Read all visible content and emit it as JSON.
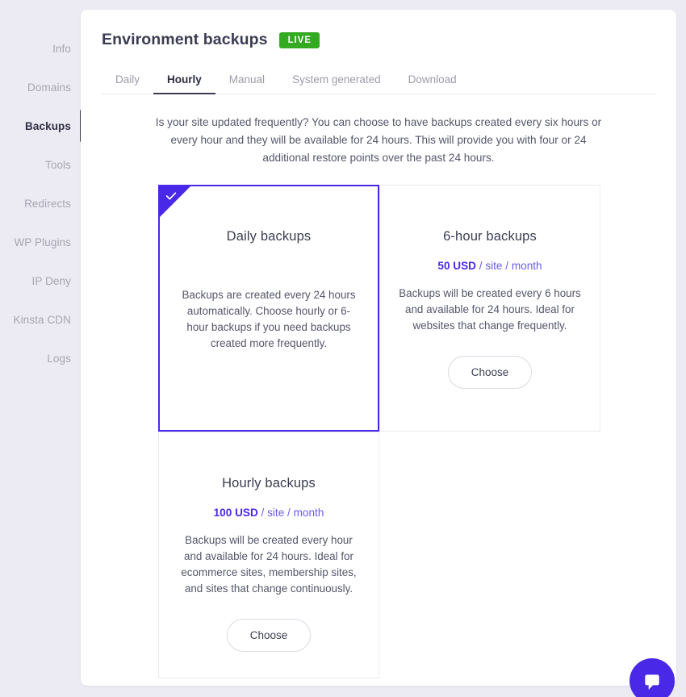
{
  "sidebar": {
    "items": [
      {
        "label": "Info",
        "active": false
      },
      {
        "label": "Domains",
        "active": false
      },
      {
        "label": "Backups",
        "active": true
      },
      {
        "label": "Tools",
        "active": false
      },
      {
        "label": "Redirects",
        "active": false
      },
      {
        "label": "WP Plugins",
        "active": false
      },
      {
        "label": "IP Deny",
        "active": false
      },
      {
        "label": "Kinsta CDN",
        "active": false
      },
      {
        "label": "Logs",
        "active": false
      }
    ]
  },
  "header": {
    "title": "Environment backups",
    "badge": "LIVE",
    "badge_color": "#33aa22"
  },
  "tabs": [
    {
      "label": "Daily",
      "active": false
    },
    {
      "label": "Hourly",
      "active": true
    },
    {
      "label": "Manual",
      "active": false
    },
    {
      "label": "System generated",
      "active": false
    },
    {
      "label": "Download",
      "active": false
    }
  ],
  "intro": "Is your site updated frequently? You can choose to have backups created every six hours or every hour and they will be available for 24 hours. This will provide you with four or 24 additional restore points over the past 24 hours.",
  "accent_color": "#4a28e8",
  "plans": [
    {
      "name": "Daily backups",
      "price_amount": "",
      "price_suffix": "",
      "description": "Backups are created every 24 hours automatically. Choose hourly or 6-hour backups if you need backups created more frequently.",
      "selected": true,
      "button": ""
    },
    {
      "name": "6-hour backups",
      "price_amount": "50 USD",
      "price_suffix": " / site / month",
      "description": "Backups will be created every 6 hours and available for 24 hours. Ideal for websites that change frequently.",
      "selected": false,
      "button": "Choose"
    },
    {
      "name": "Hourly backups",
      "price_amount": "100 USD",
      "price_suffix": " / site / month",
      "description": "Backups will be created every hour and available for 24 hours. Ideal for ecommerce sites, membership sites, and sites that change continuously.",
      "selected": false,
      "button": "Choose"
    }
  ],
  "chat": {
    "icon": "chat-bubble-icon",
    "color": "#4a28e8"
  }
}
